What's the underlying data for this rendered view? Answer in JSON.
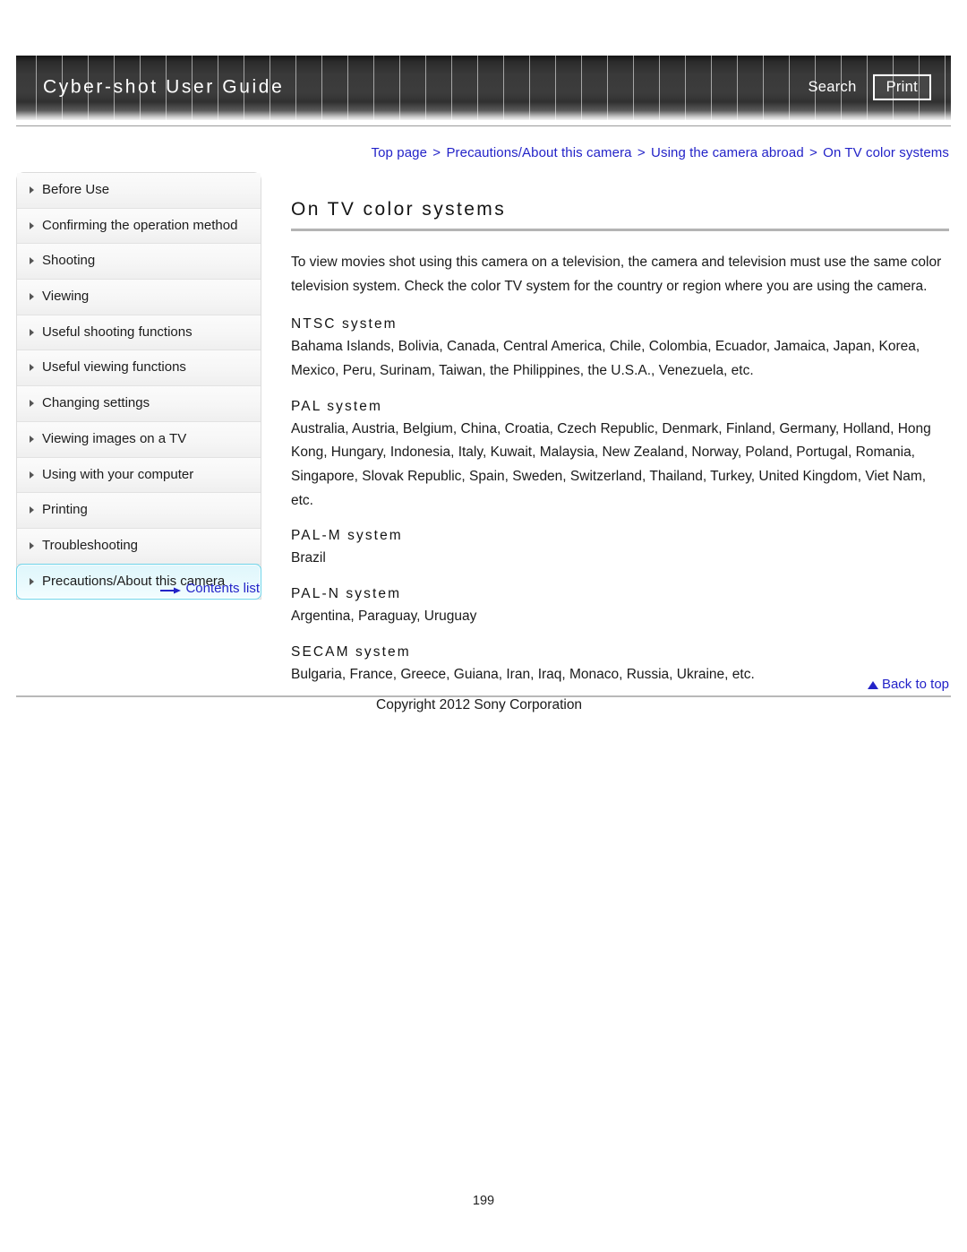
{
  "header": {
    "brand": "Cyber-shot User Guide",
    "search_label": "Search",
    "print_label": "Print"
  },
  "breadcrumb": {
    "separator": ">",
    "items": [
      "Top page",
      "Precautions/About this camera",
      "Using the camera abroad",
      "On TV color systems"
    ],
    "link_color": "#2323c8"
  },
  "sidebar": {
    "items": [
      {
        "label": "Before Use",
        "active": false
      },
      {
        "label": "Confirming the operation method",
        "active": false
      },
      {
        "label": "Shooting",
        "active": false
      },
      {
        "label": "Viewing",
        "active": false
      },
      {
        "label": "Useful shooting functions",
        "active": false
      },
      {
        "label": "Useful viewing functions",
        "active": false
      },
      {
        "label": "Changing settings",
        "active": false
      },
      {
        "label": "Viewing images on a TV",
        "active": false
      },
      {
        "label": "Using with your computer",
        "active": false
      },
      {
        "label": "Printing",
        "active": false
      },
      {
        "label": "Troubleshooting",
        "active": false
      },
      {
        "label": "Precautions/About this camera",
        "active": true
      }
    ],
    "contents_list_label": "Contents list",
    "active_highlight_color": "#dff6fc",
    "active_border_color": "#6fd5ea"
  },
  "main": {
    "title": "On TV color systems",
    "intro": "To view movies shot using this camera on a television, the camera and television must use the same color television system. Check the color TV system for the country or region where you are using the camera.",
    "sections": [
      {
        "heading": "NTSC system",
        "body": "Bahama Islands, Bolivia, Canada, Central America, Chile, Colombia, Ecuador, Jamaica, Japan, Korea, Mexico, Peru, Surinam, Taiwan, the Philippines, the U.S.A., Venezuela, etc."
      },
      {
        "heading": "PAL system",
        "body": "Australia, Austria, Belgium, China, Croatia, Czech Republic, Denmark, Finland, Germany, Holland, Hong Kong, Hungary, Indonesia, Italy, Kuwait, Malaysia, New Zealand, Norway, Poland, Portugal, Romania, Singapore, Slovak Republic, Spain, Sweden, Switzerland, Thailand, Turkey, United Kingdom, Viet Nam, etc."
      },
      {
        "heading": "PAL-M system",
        "body": "Brazil"
      },
      {
        "heading": "PAL-N system",
        "body": "Argentina, Paraguay, Uruguay"
      },
      {
        "heading": "SECAM system",
        "body": "Bulgaria, France, Greece, Guiana, Iran, Iraq, Monaco, Russia, Ukraine, etc."
      }
    ]
  },
  "footer": {
    "back_to_top_label": "Back to top",
    "copyright": "Copyright 2012 Sony Corporation",
    "page_number": "199"
  }
}
